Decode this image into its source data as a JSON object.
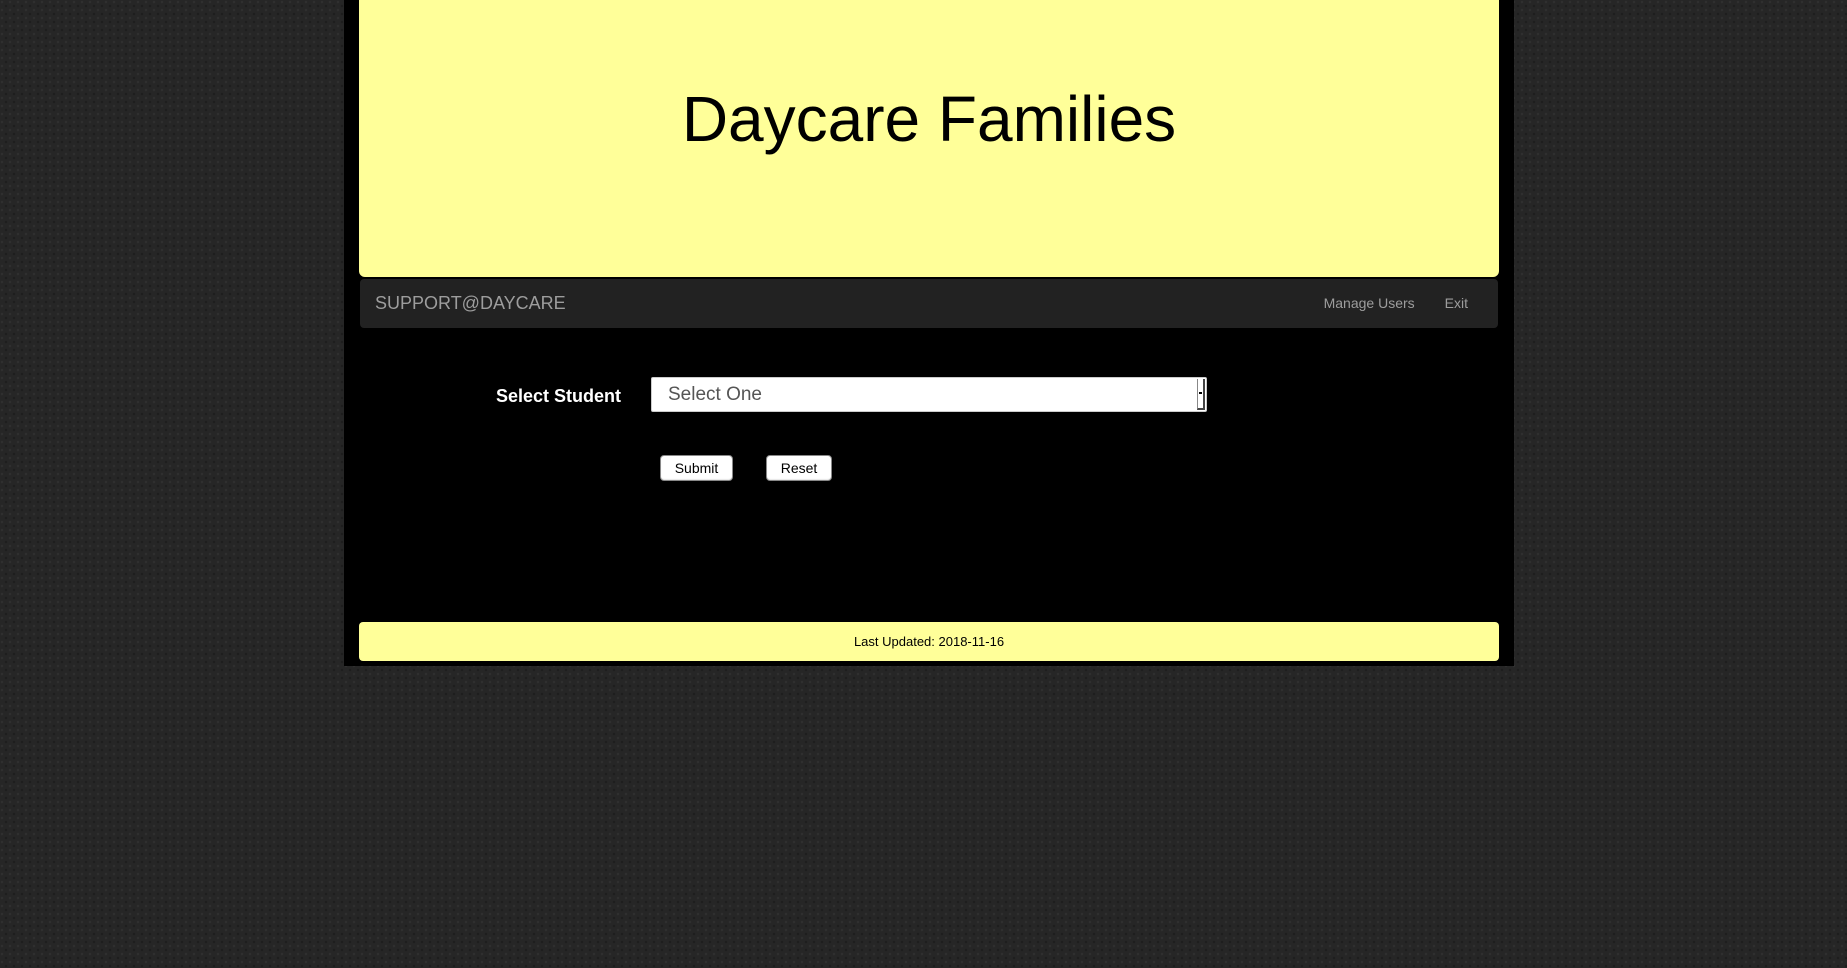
{
  "header": {
    "title": "Daycare Families"
  },
  "navbar": {
    "brand": "SUPPORT@DAYCARE",
    "links": [
      {
        "label": "Manage Users"
      },
      {
        "label": "Exit"
      }
    ]
  },
  "form": {
    "student_label": "Select Student",
    "student_select_value": "Select One",
    "submit_label": "Submit",
    "reset_label": "Reset"
  },
  "footer": {
    "last_updated": "Last Updated: 2018-11-16"
  },
  "colors": {
    "header_background": "#ffff99",
    "navbar_background": "#222222",
    "page_background": "#000000"
  }
}
